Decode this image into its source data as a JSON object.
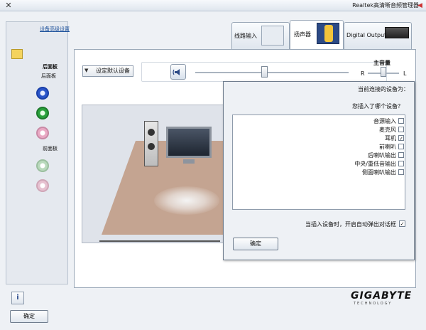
{
  "window": {
    "title": "Realtek高清晰音频管理器",
    "close_glyph": "✕",
    "app_glyph": "◀"
  },
  "sidebar": {
    "advanced_link": "设备高级设置",
    "back_panel_label": "后面板",
    "back_jacks_label": "后面板",
    "front_jacks_label": "前面板"
  },
  "tabs": [
    {
      "label": "Digital Output",
      "icon": "digital-output-icon"
    },
    {
      "label": "扬声器",
      "icon": "speaker-tab-icon"
    },
    {
      "label": "线路输入",
      "icon": "line-in-icon"
    }
  ],
  "main": {
    "volume_label": "主音量",
    "left_label": "L",
    "right_label": "R",
    "default_device_label": "设定默认设备",
    "default_device_arrow": "▼",
    "volume_level": 0.45,
    "balance_level": 0.5
  },
  "dialog": {
    "title": "当前连接的设备为：",
    "question": "您插入了哪个设备？",
    "devices": [
      {
        "label": "音源输入",
        "checked": false
      },
      {
        "label": "麦克风",
        "checked": false
      },
      {
        "label": "耳机",
        "checked": true
      },
      {
        "label": "前喇叭",
        "checked": false
      },
      {
        "label": "后喇叭输出",
        "checked": false
      },
      {
        "label": "中央/重低音输出",
        "checked": false
      },
      {
        "label": "侧面喇叭输出",
        "checked": false
      }
    ],
    "auto_popup_label": "当插入设备时，开启自动弹出对话框",
    "auto_popup_checked": true,
    "ok_label": "确定"
  },
  "footer": {
    "info_glyph": "i",
    "brand": "GIGABYTE",
    "brand_sub": "TECHNOLOGY",
    "ok_label": "确定"
  },
  "colors": {
    "accent_link": "#1a4f9a",
    "floor": "#c4a491",
    "jack_blue": "#2a55c9",
    "jack_green": "#2aa13d",
    "jack_pink": "#e9a9c4"
  }
}
